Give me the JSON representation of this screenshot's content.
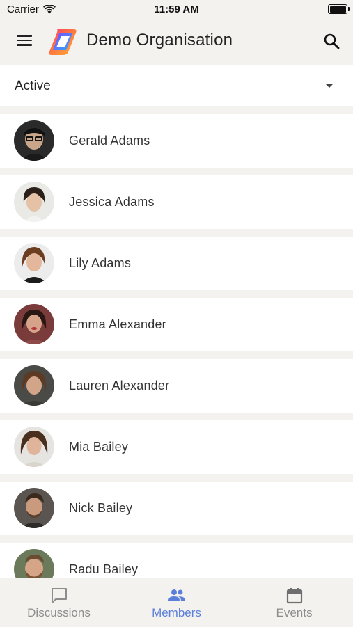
{
  "status_bar": {
    "carrier": "Carrier",
    "time": "11:59 AM"
  },
  "header": {
    "title": "Demo Organisation",
    "menu_icon": "hamburger-menu-icon",
    "search_icon": "search-icon",
    "logo": "organisation-logo"
  },
  "filter": {
    "selected": "Active",
    "icon": "caret-down-icon"
  },
  "members": [
    {
      "name": "Gerald Adams",
      "avatar_colors": [
        "#2a2a2a",
        "#c9a58a"
      ]
    },
    {
      "name": "Jessica Adams",
      "avatar_colors": [
        "#e9e9e6",
        "#e5c2a6"
      ]
    },
    {
      "name": "Lily Adams",
      "avatar_colors": [
        "#ececec",
        "#e2b79b"
      ]
    },
    {
      "name": "Emma Alexander",
      "avatar_colors": [
        "#7a3b3b",
        "#d6a38a"
      ]
    },
    {
      "name": "Lauren Alexander",
      "avatar_colors": [
        "#4a4a46",
        "#d2a588"
      ]
    },
    {
      "name": "Mia Bailey",
      "avatar_colors": [
        "#e6e4e0",
        "#dfb49a"
      ]
    },
    {
      "name": "Nick Bailey",
      "avatar_colors": [
        "#5a5550",
        "#c99a7e"
      ]
    },
    {
      "name": "Radu Bailey",
      "avatar_colors": [
        "#6b7a5a",
        "#d6a486"
      ]
    }
  ],
  "bottom_nav": [
    {
      "label": "Discussions",
      "icon": "chat-bubble-icon",
      "active": false
    },
    {
      "label": "Members",
      "icon": "people-icon",
      "active": true
    },
    {
      "label": "Events",
      "icon": "calendar-icon",
      "active": false
    }
  ],
  "colors": {
    "background": "#f3f2ef",
    "accent": "#5b7fdb",
    "inactive": "#8d8d8d"
  }
}
